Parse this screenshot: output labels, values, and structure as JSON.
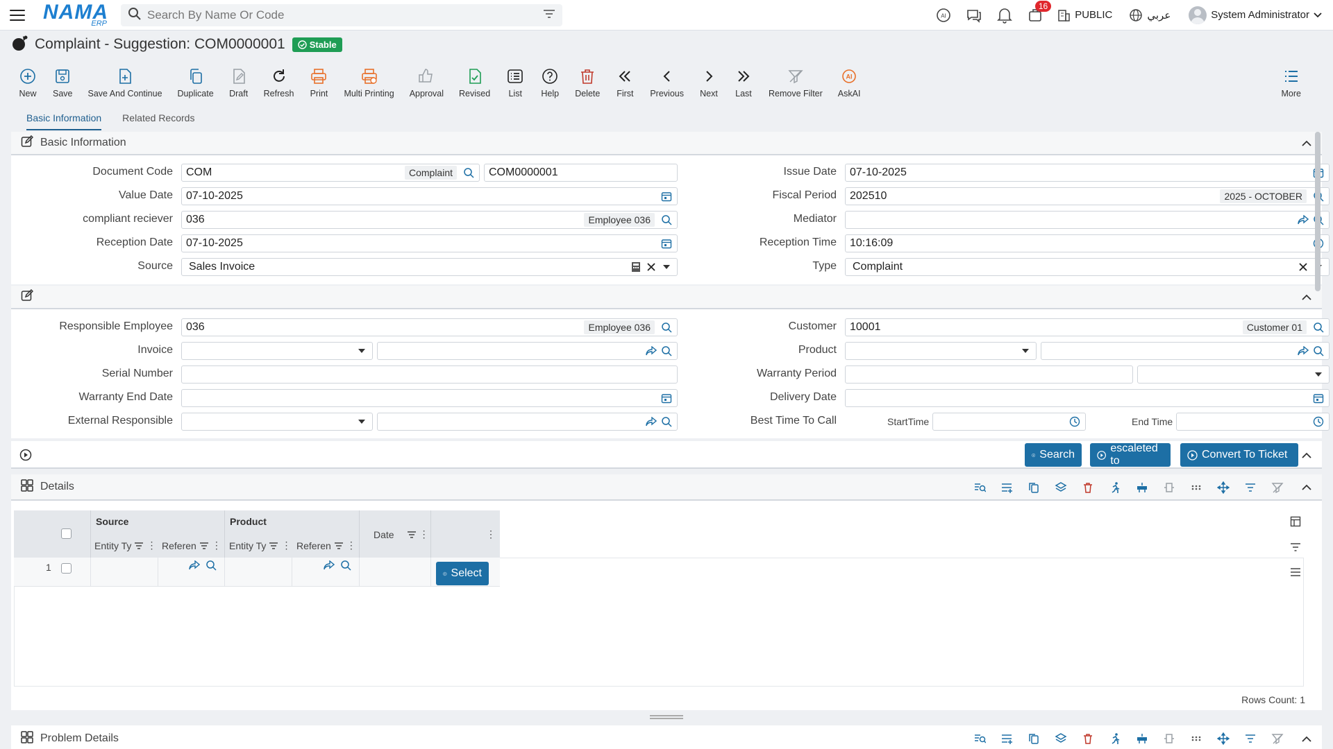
{
  "topbar": {
    "logo": "NAMA",
    "logo_sub": "ERP",
    "search_placeholder": "Search By Name Or Code",
    "notifications_badge": "16",
    "public_label": "PUBLIC",
    "language_label": "عربي",
    "user_name": "System Administrator"
  },
  "page": {
    "title": "Complaint - Suggestion: COM0000001",
    "status": "Stable"
  },
  "toolbar": {
    "items": [
      {
        "label": "New",
        "icon": "plus-circle-icon",
        "color": "#1d6fa5"
      },
      {
        "label": "Save",
        "icon": "save-icon",
        "color": "#1d6fa5"
      },
      {
        "label": "Save And Continue",
        "icon": "save-continue-icon",
        "color": "#1d6fa5"
      },
      {
        "label": "Duplicate",
        "icon": "duplicate-icon",
        "color": "#1d6fa5"
      },
      {
        "label": "Draft",
        "icon": "draft-icon",
        "color": "#9aa0a6"
      },
      {
        "label": "Refresh",
        "icon": "refresh-icon",
        "color": "#222222"
      },
      {
        "label": "Print",
        "icon": "print-icon",
        "color": "#e8702a"
      },
      {
        "label": "Multi Printing",
        "icon": "multi-print-icon",
        "color": "#e8702a"
      },
      {
        "label": "Approval",
        "icon": "thumbs-up-icon",
        "color": "#9aa0a6"
      },
      {
        "label": "Revised",
        "icon": "revised-icon",
        "color": "#1f9d55"
      },
      {
        "label": "List",
        "icon": "list-icon",
        "color": "#222222"
      },
      {
        "label": "Help",
        "icon": "help-icon",
        "color": "#222222"
      },
      {
        "label": "Delete",
        "icon": "trash-icon",
        "color": "#c0392b"
      },
      {
        "label": "First",
        "icon": "first-icon",
        "color": "#222222"
      },
      {
        "label": "Previous",
        "icon": "previous-icon",
        "color": "#222222"
      },
      {
        "label": "Next",
        "icon": "next-icon",
        "color": "#222222"
      },
      {
        "label": "Last",
        "icon": "last-icon",
        "color": "#222222"
      },
      {
        "label": "Remove Filter",
        "icon": "remove-filter-icon",
        "color": "#9aa0a6"
      },
      {
        "label": "AskAI",
        "icon": "ai-icon",
        "color": "#e8702a"
      }
    ],
    "more_label": "More"
  },
  "tabs": [
    {
      "label": "Basic Information",
      "active": true
    },
    {
      "label": "Related Records",
      "active": false
    }
  ],
  "basic": {
    "section_title": "Basic Information",
    "document_code": {
      "label": "Document Code",
      "value": "COM",
      "tag": "Complaint",
      "code": "COM0000001"
    },
    "value_date": {
      "label": "Value Date",
      "value": "07-10-2025"
    },
    "receiver": {
      "label": "compliant reciever",
      "value": "036",
      "tag": "Employee 036"
    },
    "reception_date": {
      "label": "Reception Date",
      "value": "07-10-2025"
    },
    "source": {
      "label": "Source",
      "value": "Sales Invoice"
    },
    "issue_date": {
      "label": "Issue Date",
      "value": "07-10-2025"
    },
    "fiscal_period": {
      "label": "Fiscal Period",
      "value": "202510",
      "tag": "2025 - OCTOBER"
    },
    "mediator": {
      "label": "Mediator",
      "value": ""
    },
    "reception_time": {
      "label": "Reception Time",
      "value": "10:16:09"
    },
    "type": {
      "label": "Type",
      "value": "Complaint"
    }
  },
  "second": {
    "responsible_employee": {
      "label": "Responsible Employee",
      "value": "036",
      "tag": "Employee 036"
    },
    "invoice": {
      "label": "Invoice"
    },
    "serial_number": {
      "label": "Serial Number"
    },
    "warranty_end_date": {
      "label": "Warranty End Date"
    },
    "external_responsible": {
      "label": "External Responsible"
    },
    "customer": {
      "label": "Customer",
      "value": "10001",
      "tag": "Customer 01"
    },
    "product": {
      "label": "Product"
    },
    "warranty_period": {
      "label": "Warranty Period"
    },
    "delivery_date": {
      "label": "Delivery Date"
    },
    "best_time": {
      "label": "Best Time To Call",
      "start_label": "StartTime",
      "end_label": "End Time"
    }
  },
  "actions": {
    "search": "Search",
    "escalated": "escaleted to",
    "convert": "Convert To Ticket"
  },
  "details": {
    "title": "Details",
    "group_source": "Source",
    "group_product": "Product",
    "col_entity_type": "Entity Ty",
    "col_reference": "Referen",
    "col_entity_type2": "Entity Ty",
    "col_reference2": "Referen",
    "col_date": "Date",
    "row_number": "1",
    "select_label": "Select",
    "rows_count": "Rows Count: 1"
  },
  "problem_details": {
    "title": "Problem Details"
  }
}
